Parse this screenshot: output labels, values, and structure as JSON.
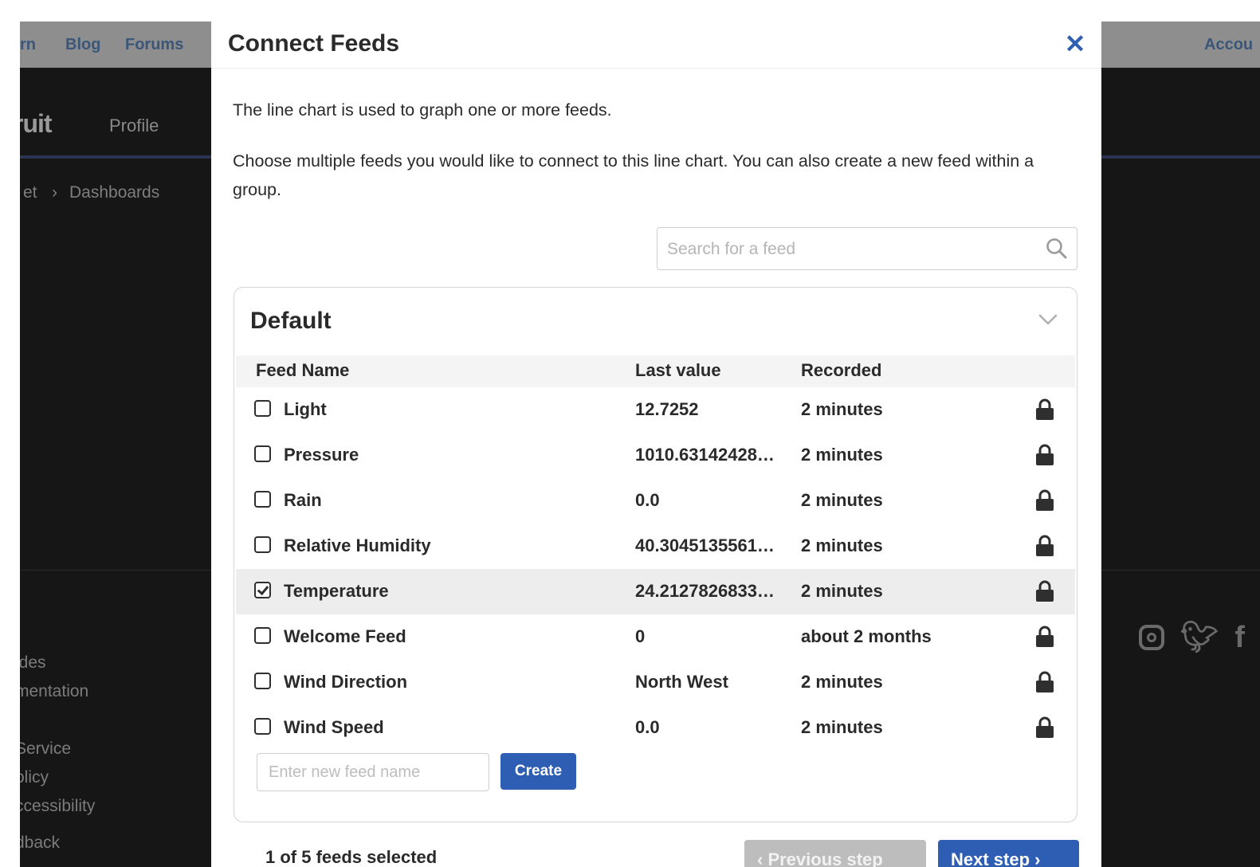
{
  "background": {
    "top_links": [
      "rn",
      "Blog",
      "Forums"
    ],
    "account_link": "Accou",
    "brand": "ruit",
    "profile": "Profile",
    "breadcrumb": [
      "et",
      "Dashboards"
    ],
    "footer_links": [
      "ides",
      "mentation",
      "Service",
      "olicy",
      "ccessibility",
      "dback"
    ],
    "social_icons": [
      "instagram-icon",
      "twitter-icon",
      "facebook-icon"
    ]
  },
  "modal": {
    "title": "Connect Feeds",
    "close_icon": "close-icon",
    "description_1": "The line chart is used to graph one or more feeds.",
    "description_2": "Choose multiple feeds you would like to connect to this line chart. You can also create a new feed within a group.",
    "search": {
      "placeholder": "Search for a feed",
      "value": ""
    },
    "group": {
      "name": "Default",
      "columns": {
        "name": "Feed Name",
        "value": "Last value",
        "recorded": "Recorded"
      },
      "feeds": [
        {
          "name": "Light",
          "value": "12.7252",
          "recorded": "2 minutes",
          "checked": false
        },
        {
          "name": "Pressure",
          "value": "1010.63142428…",
          "recorded": "2 minutes",
          "checked": false
        },
        {
          "name": "Rain",
          "value": "0.0",
          "recorded": "2 minutes",
          "checked": false
        },
        {
          "name": "Relative Humidity",
          "value": "40.3045135561…",
          "recorded": "2 minutes",
          "checked": false
        },
        {
          "name": "Temperature",
          "value": "24.2127826833…",
          "recorded": "2 minutes",
          "checked": true
        },
        {
          "name": "Welcome Feed",
          "value": "0",
          "recorded": "about 2 months",
          "checked": false
        },
        {
          "name": "Wind Direction",
          "value": "North West",
          "recorded": "2 minutes",
          "checked": false
        },
        {
          "name": "Wind Speed",
          "value": "0.0",
          "recorded": "2 minutes",
          "checked": false
        }
      ],
      "new_feed_placeholder": "Enter new feed name",
      "create_label": "Create"
    },
    "footer": {
      "status": "1 of 5 feeds selected",
      "previous_label": "‹ Previous step",
      "next_label": "Next step ›"
    }
  },
  "colors": {
    "accent": "#2d5eb3",
    "overlay": "#161616",
    "selected_row": "#ededed"
  }
}
